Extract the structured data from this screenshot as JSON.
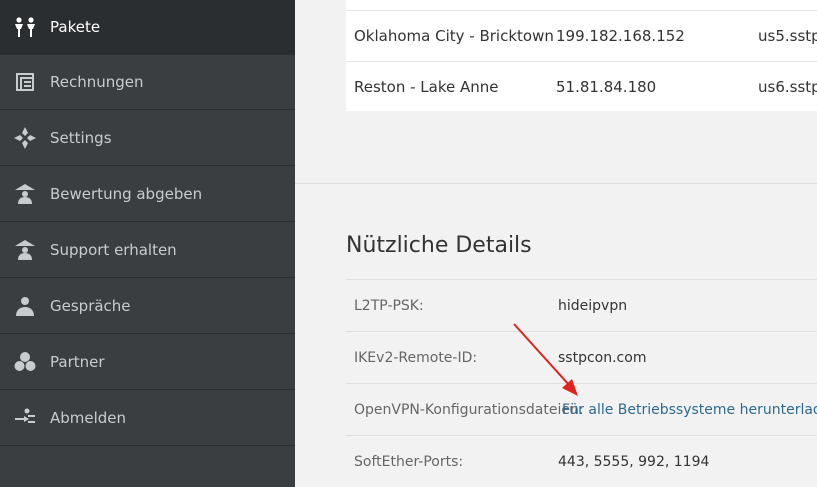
{
  "sidebar": {
    "items": [
      {
        "label": "Pakete",
        "icon": "people-icon"
      },
      {
        "label": "Rechnungen",
        "icon": "invoice-icon"
      },
      {
        "label": "Settings",
        "icon": "settings-icon"
      },
      {
        "label": "Bewertung abgeben",
        "icon": "rating-icon"
      },
      {
        "label": "Support erhalten",
        "icon": "support-icon"
      },
      {
        "label": "Gespräche",
        "icon": "chat-icon"
      },
      {
        "label": "Partner",
        "icon": "partner-icon"
      },
      {
        "label": "Abmelden",
        "icon": "logout-icon"
      }
    ]
  },
  "servers": [
    {
      "location": "Oklahoma City - Bricktown",
      "ip": "199.182.168.152",
      "host": "us5.sstp"
    },
    {
      "location": "Reston - Lake Anne",
      "ip": "51.81.84.180",
      "host": "us6.sstp"
    }
  ],
  "details": {
    "title": "Nützliche Details",
    "rows": [
      {
        "label": "L2TP-PSK:",
        "value": "hideipvpn"
      },
      {
        "label": "IKEv2-Remote-ID:",
        "value": "sstpcon.com"
      },
      {
        "label": "OpenVPN-Konfigurationsdateien:",
        "value": "Für alle Betriebssysteme herunterladen"
      },
      {
        "label": "SoftEther-Ports:",
        "value": "443, 5555, 992, 1194"
      }
    ]
  },
  "colors": {
    "sidebar_bg": "#3a3e41",
    "sidebar_active": "#2b2e30",
    "link": "#2d6a8f",
    "arrow": "#e0231c"
  }
}
